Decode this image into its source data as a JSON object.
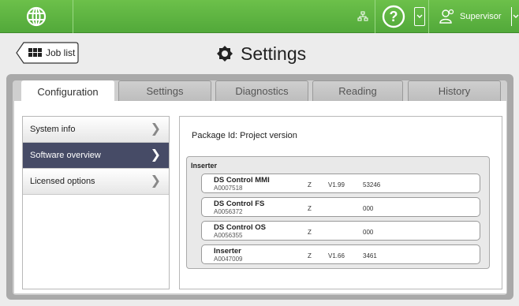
{
  "header": {
    "user_label": "Supervisor",
    "help_glyph": "?",
    "icons": [
      "globe-icon",
      "network-icon",
      "help-icon",
      "user-icon",
      "chevron-down-icon"
    ],
    "accent_color": "#5cb343"
  },
  "nav": {
    "job_list_label": "Job list",
    "page_title": "Settings"
  },
  "tabs": [
    {
      "label": "Configuration",
      "active": true
    },
    {
      "label": "Settings",
      "active": false
    },
    {
      "label": "Diagnostics",
      "active": false
    },
    {
      "label": "Reading",
      "active": false
    },
    {
      "label": "History",
      "active": false
    }
  ],
  "sidebar": {
    "items": [
      {
        "label": "System info",
        "selected": false
      },
      {
        "label": "Software overview",
        "selected": true
      },
      {
        "label": "Licensed options",
        "selected": false
      }
    ]
  },
  "panel": {
    "package_label": "Package Id: Project version",
    "group_title": "Inserter",
    "rows": [
      {
        "name": "DS Control MMI",
        "code": "A0007518",
        "z": "Z",
        "version": "V1.99",
        "number": "53246"
      },
      {
        "name": "DS Control FS",
        "code": "A0056372",
        "z": "Z",
        "version": "",
        "number": "000"
      },
      {
        "name": "DS Control OS",
        "code": "A0056355",
        "z": "Z",
        "version": "",
        "number": "000"
      },
      {
        "name": "Inserter",
        "code": "A0047009",
        "z": "Z",
        "version": "V1.66",
        "number": "3461"
      }
    ]
  }
}
